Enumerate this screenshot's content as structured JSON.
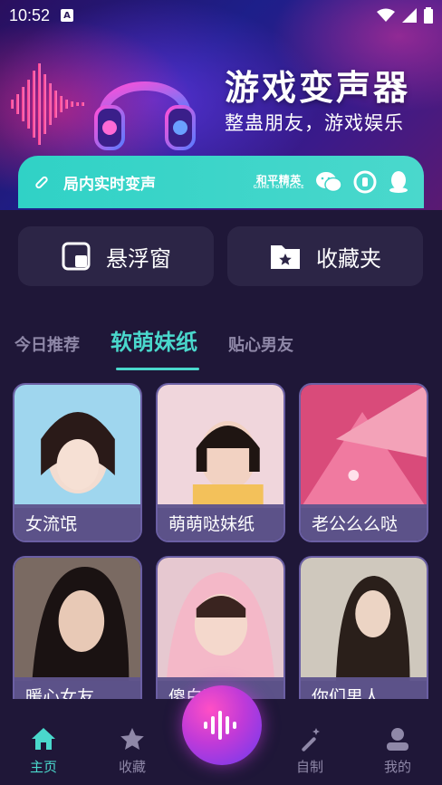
{
  "status_bar": {
    "time": "10:52",
    "indicator": "A"
  },
  "hero": {
    "title": "游戏变声器",
    "subtitle": "整蛊朋友，游戏娱乐"
  },
  "realtime_bar": {
    "label": "局内实时变声",
    "game_logo": "和平精英",
    "game_logo_sub": "GAME FOR PEACE",
    "icons": [
      "wechat-icon",
      "game-icon",
      "qq-icon"
    ]
  },
  "quick_actions": {
    "float_window": "悬浮窗",
    "favorites": "收藏夹"
  },
  "tabs": [
    {
      "label": "今日推荐",
      "active": false
    },
    {
      "label": "软萌妹纸",
      "active": true
    },
    {
      "label": "贴心男友",
      "active": false
    }
  ],
  "cards": [
    {
      "label": "女流氓"
    },
    {
      "label": "萌萌哒妹纸"
    },
    {
      "label": "老公么么哒"
    },
    {
      "label": "暖心女友"
    },
    {
      "label": "傻白甜哥"
    },
    {
      "label": "你们男人"
    }
  ],
  "bottom_nav": {
    "home": "主页",
    "favorites": "收藏",
    "custom": "自制",
    "mine": "我的"
  },
  "colors": {
    "accent": "#4ad8cc",
    "background": "#1f1738",
    "card_label": "#5f548c",
    "inactive": "#8f88a8"
  }
}
